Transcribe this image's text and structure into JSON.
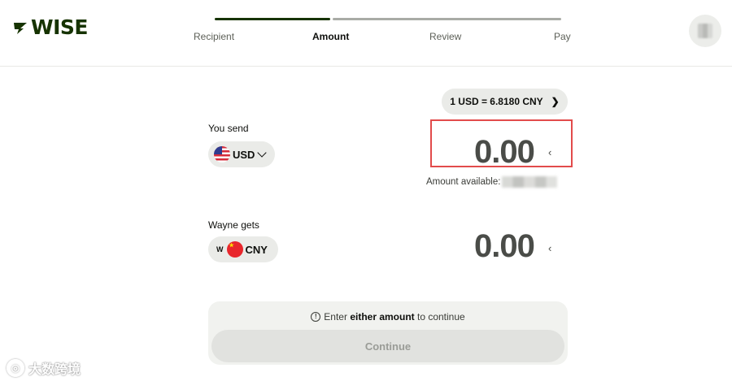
{
  "header": {
    "logo_text": "WISE",
    "brand_color": "#163300",
    "steps": [
      {
        "label": "Recipient",
        "state": "done"
      },
      {
        "label": "Amount",
        "state": "active"
      },
      {
        "label": "Review",
        "state": "todo"
      },
      {
        "label": "Pay",
        "state": "todo"
      }
    ],
    "avatar_icon": "blurred-avatar"
  },
  "rate": {
    "label": "1 USD = 6.8180 CNY",
    "icon": "chevron-right-icon"
  },
  "send": {
    "label": "You send",
    "currency": "USD",
    "flag": "us-flag-icon",
    "amount": "0.00",
    "available_label": "Amount available:",
    "highlight_color": "#e24b4b"
  },
  "receive": {
    "label": "Wayne gets",
    "badge": "W",
    "currency": "CNY",
    "flag": "cn-flag-icon",
    "amount": "0.00"
  },
  "footer": {
    "hint_prefix": "Enter ",
    "hint_bold": "either amount",
    "hint_suffix": " to continue",
    "continue_label": "Continue",
    "continue_state": "disabled"
  },
  "watermark": {
    "text": "大数跨境"
  }
}
